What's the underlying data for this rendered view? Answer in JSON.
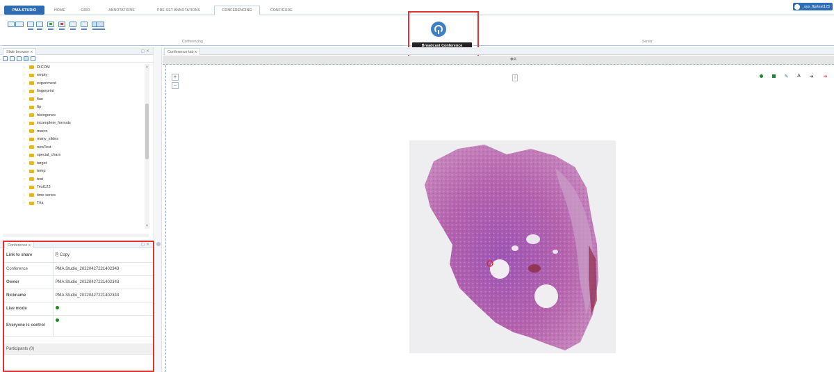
{
  "menubar": {
    "brand": "PMA.STUDIO",
    "tabs": [
      "HOME",
      "GRID",
      "ANNOTATIONS",
      "PRE-SET ANNOTATIONS",
      "CONFERENCING",
      "CONFIGURE"
    ],
    "active_tab": "CONFERENCING",
    "user": "_sys_ftp/test123"
  },
  "ribbon": {
    "group_conferencing": "Conferencing",
    "group_server": "Server",
    "broadcast_tooltip": "Broadcast Conference"
  },
  "slide_browser": {
    "title": "Slide browser",
    "folders": [
      "DICOM",
      "empty",
      "experiment",
      "fingerprint",
      "flue",
      "ftp",
      "histogenex",
      "incomplete_formats",
      "macro",
      "many_slides",
      "newTest",
      "special_chars",
      "target",
      "temp",
      "test",
      "Test123",
      "time series",
      "Tria"
    ]
  },
  "conference_panel": {
    "title": "Conference",
    "link_label": "Link to share",
    "copy_label": "Copy",
    "conference_label": "Conference",
    "conference_value": "PMA.Studio_20220427221402343",
    "owner_label": "Owner",
    "owner_value": "PMA.Studio_20220427221402343",
    "nickname_label": "Nickname",
    "nickname_value": "PMA.Studio_20220427221402343",
    "live_label": "Live mode",
    "control_label": "Everyone is control",
    "participants_label": "Participants (0)"
  },
  "viewer": {
    "tab_title": "Conference tab",
    "anchor": "A",
    "zoom_in": "+",
    "zoom_out": "−",
    "info": "i"
  },
  "colors": {
    "brand": "#2e6db4",
    "highlight": "#e53030",
    "live_dot": "#1d8a1d",
    "tissue": "#b65aa8"
  }
}
